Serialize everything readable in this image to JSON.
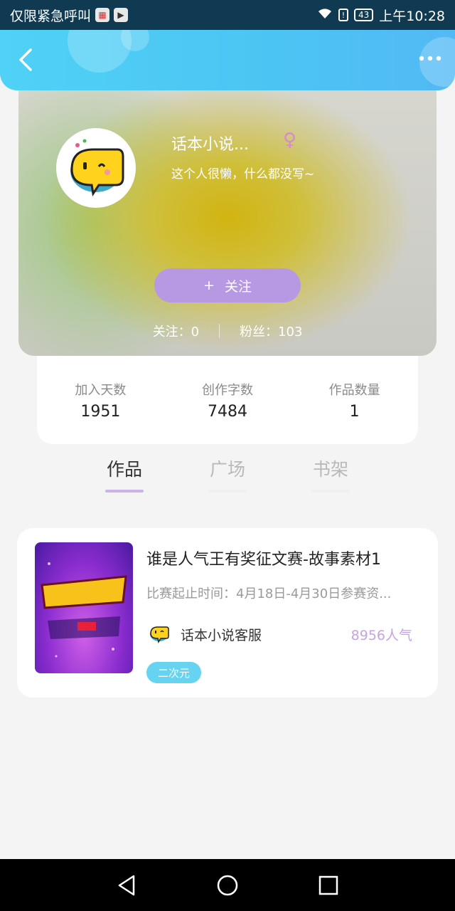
{
  "status_bar": {
    "left_text": "仅限紧急呼叫",
    "battery": "43",
    "time": "上午10:28",
    "icons": [
      "calendar-icon",
      "play-store-icon",
      "wifi-icon",
      "alert-icon",
      "battery-icon"
    ]
  },
  "header": {
    "back_icon": "‹",
    "more_icon": "•••"
  },
  "profile": {
    "username": "话本小说...",
    "gender_symbol": "♀",
    "bio": "这个人很懒，什么都没写~",
    "follow_plus": "+",
    "follow_label": "关注",
    "following_label": "关注：",
    "following_count": "0",
    "fans_label": "粉丝：",
    "fans_count": "103"
  },
  "stats": [
    {
      "label": "加入天数",
      "value": "1951"
    },
    {
      "label": "创作字数",
      "value": "7484"
    },
    {
      "label": "作品数量",
      "value": "1"
    }
  ],
  "tabs": [
    {
      "label": "作品",
      "active": true
    },
    {
      "label": "广场",
      "active": false
    },
    {
      "label": "书架",
      "active": false
    }
  ],
  "works": [
    {
      "title": "谁是人气王有奖征文赛-故事素材1",
      "description": "比赛起止时间：4月18日-4月30日参赛资...",
      "author": "话本小说客服",
      "popularity": "8956人气",
      "tag": "二次元"
    }
  ],
  "colors": {
    "header": "#4fd2f6",
    "follow_button": "#b798e3",
    "tab_underline": "#c9b3e8",
    "popularity": "#c6a4e3",
    "tag": "#66d3f0"
  }
}
